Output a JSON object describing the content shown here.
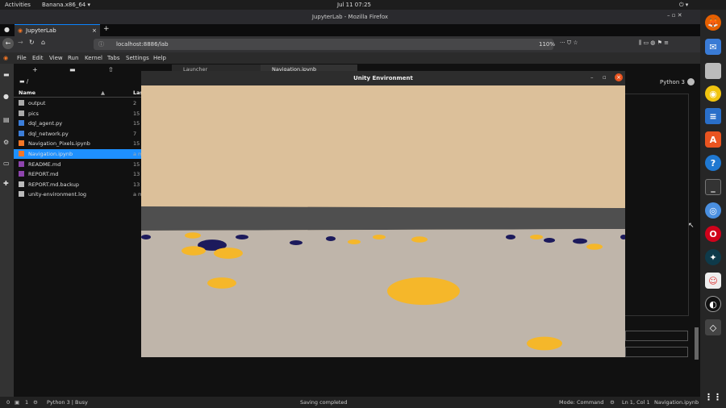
{
  "topbar": {
    "activities": "Activities",
    "app": "Banana.x86_64 ▾",
    "clock": "Jul 11  07:25"
  },
  "firefox": {
    "window_title": "JupyterLab - Mozilla Firefox",
    "tab_label": "JupyterLab",
    "new_tab": "+",
    "url": "localhost:8886/lab",
    "zoom": "110%"
  },
  "jupyter_menu": [
    "File",
    "Edit",
    "View",
    "Run",
    "Kernel",
    "Tabs",
    "Settings",
    "Help"
  ],
  "file_browser": {
    "path": "/",
    "col_name": "Name",
    "col_last": "Last",
    "items": [
      {
        "name": "output",
        "type": "folder",
        "last": "2"
      },
      {
        "name": "pics",
        "type": "folder",
        "last": "15"
      },
      {
        "name": "dql_agent.py",
        "type": "python",
        "last": "15"
      },
      {
        "name": "dql_network.py",
        "type": "python",
        "last": "7"
      },
      {
        "name": "Navigation_Pixels.ipynb",
        "type": "notebook",
        "last": "15"
      },
      {
        "name": "Navigation.ipynb",
        "type": "notebook",
        "last": "a m",
        "selected": true
      },
      {
        "name": "README.md",
        "type": "markdown",
        "last": "15"
      },
      {
        "name": "REPORT.md",
        "type": "markdown",
        "last": "13"
      },
      {
        "name": "REPORT.md.backup",
        "type": "file",
        "last": "13"
      },
      {
        "name": "unity-environment.log",
        "type": "file",
        "last": "a m"
      }
    ]
  },
  "main_tabs": [
    "Launcher",
    "Navigation.ipynb"
  ],
  "kernel_label": "Python 3",
  "unity": {
    "title": "Unity Environment"
  },
  "statusbar": {
    "left_count_a": "0",
    "left_count_b": "1",
    "kernel": "Python 3 | Busy",
    "center": "Saving completed",
    "mode": "Mode: Command",
    "cursor": "Ln 1, Col 1",
    "file": "Navigation.ipynb"
  },
  "colors": {
    "accent": "#0a84ff",
    "selected_file": "#1e90ff",
    "sky": "#dcc09a",
    "floor": "#bdb3a8",
    "wall": "#505050",
    "banana": "#f5b72a",
    "blue_banana": "#1c1a5c"
  }
}
